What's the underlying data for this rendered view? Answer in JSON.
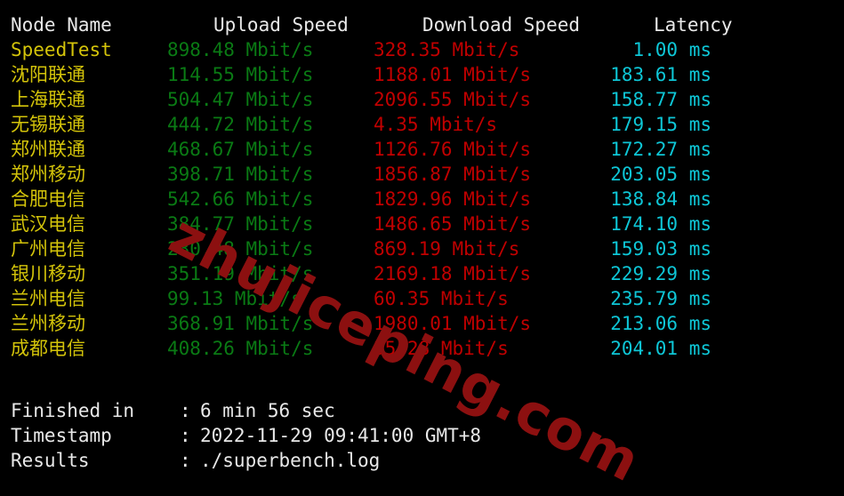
{
  "terminal": {
    "background_color": "#000000",
    "rule_text": "- - - - - - - - - - - - - - - - - - - - - - - - - - - - - - - - - - - - - - - - - - - - - - - - - - - - - -"
  },
  "colors": {
    "header": "#e8e8e8",
    "node": "#d4c40a",
    "upload": "#0a7a14",
    "download": "#c00000",
    "latency": "#0ec6d6",
    "watermark": "#8c1010"
  },
  "watermark": {
    "text": "zhujiceping.com"
  },
  "table": {
    "headers": {
      "node": "Node Name",
      "upload": "Upload Speed",
      "download": "Download Speed",
      "latency": "Latency"
    },
    "rows": [
      {
        "node": "SpeedTest",
        "upload": "898.48 Mbit/s",
        "download": "328.35 Mbit/s",
        "latency": "1.00 ms"
      },
      {
        "node": "沈阳联通",
        "upload": "114.55 Mbit/s",
        "download": "1188.01 Mbit/s",
        "latency": "183.61 ms"
      },
      {
        "node": "上海联通",
        "upload": "504.47 Mbit/s",
        "download": "2096.55 Mbit/s",
        "latency": "158.77 ms"
      },
      {
        "node": "无锡联通",
        "upload": "444.72 Mbit/s",
        "download": "4.35 Mbit/s",
        "latency": "179.15 ms"
      },
      {
        "node": "郑州联通",
        "upload": "468.67 Mbit/s",
        "download": "1126.76 Mbit/s",
        "latency": "172.27 ms"
      },
      {
        "node": "郑州移动",
        "upload": "398.71 Mbit/s",
        "download": "1856.87 Mbit/s",
        "latency": "203.05 ms"
      },
      {
        "node": "合肥电信",
        "upload": "542.66 Mbit/s",
        "download": "1829.96 Mbit/s",
        "latency": "138.84 ms"
      },
      {
        "node": "武汉电信",
        "upload": "384.77 Mbit/s",
        "download": "1486.65 Mbit/s",
        "latency": "174.10 ms"
      },
      {
        "node": "广州电信",
        "upload": "230.48 Mbit/s",
        "download": "869.19 Mbit/s",
        "latency": "159.03 ms"
      },
      {
        "node": "银川移动",
        "upload": "351.19 Mbit/s",
        "download": "2169.18 Mbit/s",
        "latency": "229.29 ms"
      },
      {
        "node": "兰州电信",
        "upload": "99.13 Mbit/s",
        "download": "60.35 Mbit/s",
        "latency": "235.79 ms"
      },
      {
        "node": "兰州移动",
        "upload": "368.91 Mbit/s",
        "download": "1980.01 Mbit/s",
        "latency": "213.06 ms"
      },
      {
        "node": "成都电信",
        "upload": "408.26 Mbit/s",
        "download": "35.28 Mbit/s",
        "latency": "204.01 ms"
      }
    ]
  },
  "summary": {
    "separator": ":",
    "rows": [
      {
        "label": "Finished in",
        "value": "6 min 56 sec"
      },
      {
        "label": "Timestamp",
        "value": "2022-11-29 09:41:00 GMT+8"
      },
      {
        "label": "Results",
        "value": "./superbench.log"
      }
    ]
  }
}
